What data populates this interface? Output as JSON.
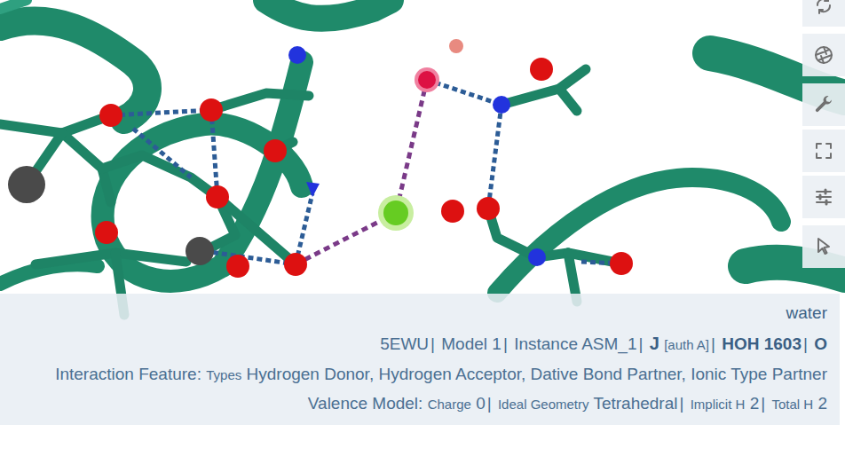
{
  "title": "water",
  "location": [
    {
      "text": "5EWU",
      "kind": "plain"
    },
    {
      "text": "Model 1",
      "kind": "plain"
    },
    {
      "text": "Instance ASM_1",
      "kind": "plain"
    },
    {
      "text": "J",
      "kind": "chain",
      "auth": "[auth A]"
    },
    {
      "text": "HOH 1603",
      "kind": "bold"
    },
    {
      "text": "O",
      "kind": "bold"
    }
  ],
  "separator": "|",
  "interaction": {
    "label": "Interaction Feature:",
    "sublabel": "Types",
    "value": "Hydrogen Donor, Hydrogen Acceptor, Dative Bond Partner, Ionic Type Partner"
  },
  "valence": {
    "label": "Valence Model:",
    "fields": [
      {
        "label": "Charge",
        "value": "0"
      },
      {
        "label": "Ideal Geometry",
        "value": "Tetrahedral"
      },
      {
        "label": "Implicit H",
        "value": "2"
      },
      {
        "label": "Total H",
        "value": "2"
      }
    ]
  }
}
